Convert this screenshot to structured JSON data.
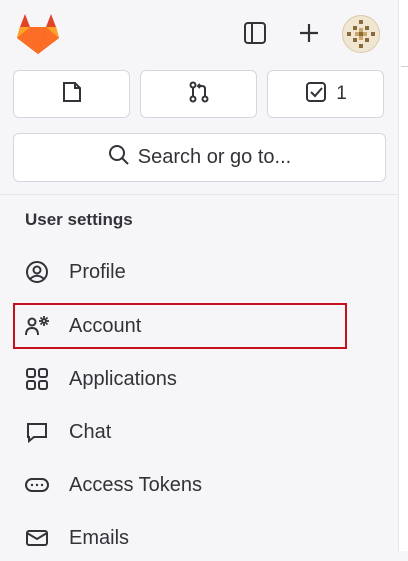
{
  "topbar": {
    "logo_icon": "gitlab-tanuki-logo",
    "sidebar_toggle_icon": "sidebar-toggle-icon",
    "new_icon": "plus-icon",
    "avatar_icon": "user-avatar"
  },
  "quick_actions": [
    {
      "icon": "issues-icon",
      "count": ""
    },
    {
      "icon": "merge-request-icon",
      "count": ""
    },
    {
      "icon": "todo-checkbox-icon",
      "count": "1"
    }
  ],
  "search": {
    "label": "Search or go to..."
  },
  "section": {
    "title": "User settings"
  },
  "nav": {
    "profile": "Profile",
    "account": "Account",
    "applications": "Applications",
    "chat": "Chat",
    "access_tokens": "Access Tokens",
    "emails": "Emails"
  },
  "colors": {
    "highlight_border": "#c5101d",
    "logo_orange": "#fc6d26",
    "logo_dark": "#e24329",
    "logo_light": "#fca326"
  }
}
